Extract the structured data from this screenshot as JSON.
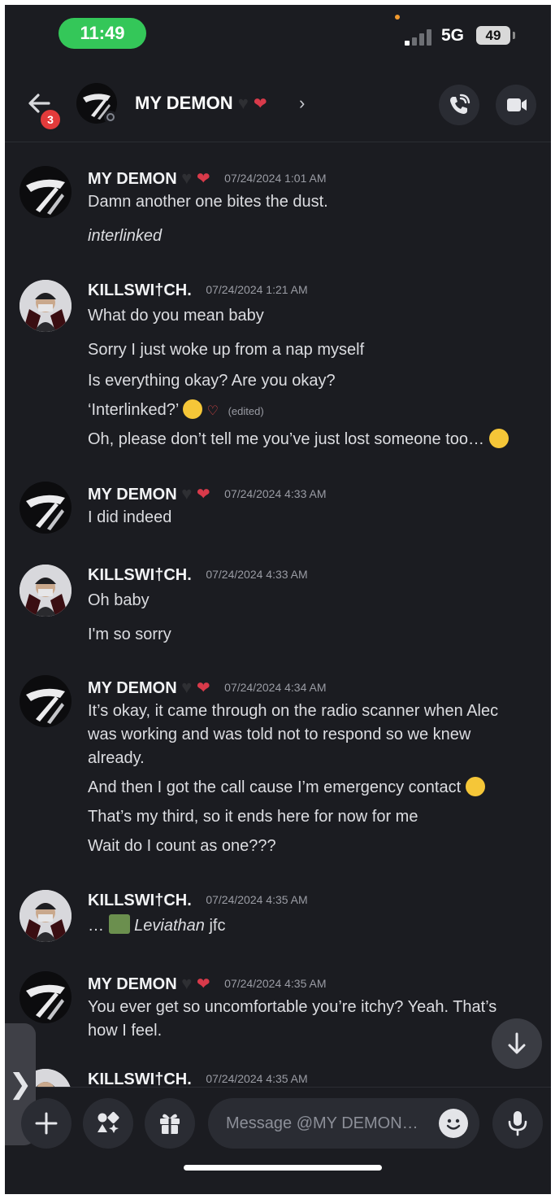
{
  "status_bar": {
    "time": "11:49",
    "network": "5G",
    "battery": "49"
  },
  "header": {
    "badge_count": "3",
    "title": "MY DEMON",
    "chevron": "›"
  },
  "messages": [
    {
      "author": "MY DEMON",
      "timestamp": "07/24/2024 1:01 AM",
      "lines": [
        "Damn another one bites the dust.",
        "interlinked"
      ]
    },
    {
      "author": "KILLSWI†CH.",
      "timestamp": "07/24/2024 1:21 AM",
      "lines": [
        "What do you mean baby",
        "Sorry I just woke up from a nap myself",
        "Is everything okay? Are you okay?",
        "‘Interlinked?’",
        "Oh, please don’t tell me you’ve just lost someone too…"
      ],
      "edited": "(edited)"
    },
    {
      "author": "MY DEMON",
      "timestamp": "07/24/2024 4:33 AM",
      "lines": [
        "I did indeed"
      ]
    },
    {
      "author": "KILLSWI†CH.",
      "timestamp": "07/24/2024 4:33 AM",
      "lines": [
        "Oh baby",
        "I'm so sorry"
      ]
    },
    {
      "author": "MY DEMON",
      "timestamp": "07/24/2024 4:34 AM",
      "lines": [
        "It’s okay, it came through on the radio scanner when Alec",
        "was working and was told not to respond so we knew",
        "already.",
        "And then I got the call cause I’m emergency contact",
        "That’s my third, so it ends here for now for me",
        "Wait do I count as one???"
      ]
    },
    {
      "author": "KILLSWI†CH.",
      "timestamp": "07/24/2024 4:35 AM",
      "lines": [
        "…",
        "Leviathan",
        "jfc"
      ]
    },
    {
      "author": "MY DEMON",
      "timestamp": "07/24/2024 4:35 AM",
      "lines": [
        "You ever get so uncomfortable you’re itchy? Yeah. That’s",
        "how I feel."
      ]
    },
    {
      "author": "KILLSWI†CH.",
      "timestamp": "07/24/2024 4:35 AM",
      "lines": []
    }
  ],
  "composer": {
    "placeholder": "Message @MY DEMON…",
    "side_tab": "❯"
  },
  "colors": {
    "background": "#1b1c21",
    "status_pill": "#34c759",
    "badge": "#e23b3b"
  },
  "icons": [
    "back-arrow-icon",
    "phone-call-icon",
    "video-camera-icon",
    "arrow-down-icon",
    "plus-icon",
    "apps-icon",
    "gift-icon",
    "emoji-icon",
    "microphone-icon",
    "black-heart-icon",
    "anatomical-heart-icon"
  ]
}
